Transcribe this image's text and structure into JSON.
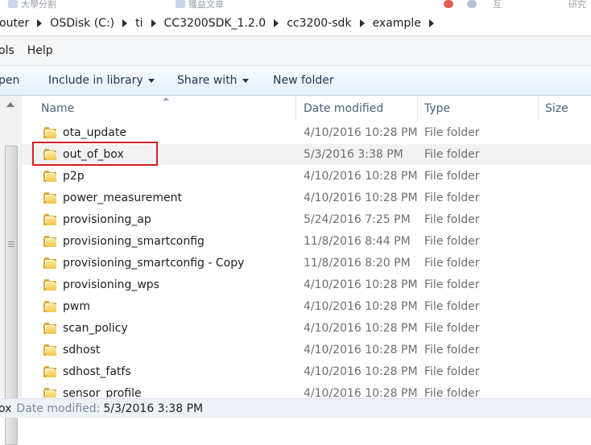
{
  "top_strip": {
    "items": [
      "大學分割",
      "獲益文章",
      "互",
      "研究"
    ]
  },
  "address": {
    "crumbs": [
      "outer",
      "OSDisk (C:)",
      "ti",
      "CC3200SDK_1.2.0",
      "cc3200-sdk",
      "example"
    ]
  },
  "menu": {
    "items": [
      "ols",
      "Help"
    ]
  },
  "commands": {
    "open": "pen",
    "include": "Include in library",
    "share": "Share with",
    "new_folder": "New folder"
  },
  "columns": {
    "name": "Name",
    "date": "Date modified",
    "type": "Type",
    "size": "Size"
  },
  "files": [
    {
      "name": "ota_update",
      "date": "4/10/2016 10:28 PM",
      "type": "File folder"
    },
    {
      "name": "out_of_box",
      "date": "5/3/2016 3:38 PM",
      "type": "File folder"
    },
    {
      "name": "p2p",
      "date": "4/10/2016 10:28 PM",
      "type": "File folder"
    },
    {
      "name": "power_measurement",
      "date": "4/10/2016 10:28 PM",
      "type": "File folder"
    },
    {
      "name": "provisioning_ap",
      "date": "5/24/2016 7:25 PM",
      "type": "File folder"
    },
    {
      "name": "provisioning_smartconfig",
      "date": "11/8/2016 8:44 PM",
      "type": "File folder"
    },
    {
      "name": "provisioning_smartconfig - Copy",
      "date": "11/8/2016 8:20 PM",
      "type": "File folder"
    },
    {
      "name": "provisioning_wps",
      "date": "4/10/2016 10:28 PM",
      "type": "File folder"
    },
    {
      "name": "pwm",
      "date": "4/10/2016 10:28 PM",
      "type": "File folder"
    },
    {
      "name": "scan_policy",
      "date": "4/10/2016 10:28 PM",
      "type": "File folder"
    },
    {
      "name": "sdhost",
      "date": "4/10/2016 10:28 PM",
      "type": "File folder"
    },
    {
      "name": "sdhost_fatfs",
      "date": "4/10/2016 10:28 PM",
      "type": "File folder"
    },
    {
      "name": "sensor_profile",
      "date": "4/10/2016 10:28 PM",
      "type": "File folder"
    }
  ],
  "selected_file": "out_of_box",
  "status": {
    "name": "ox",
    "label": "Date modified:",
    "value": "5/3/2016 3:38 PM"
  },
  "colors": {
    "highlight": "#d32020",
    "folder": "#f1c64d",
    "link_text": "#1e3557"
  }
}
